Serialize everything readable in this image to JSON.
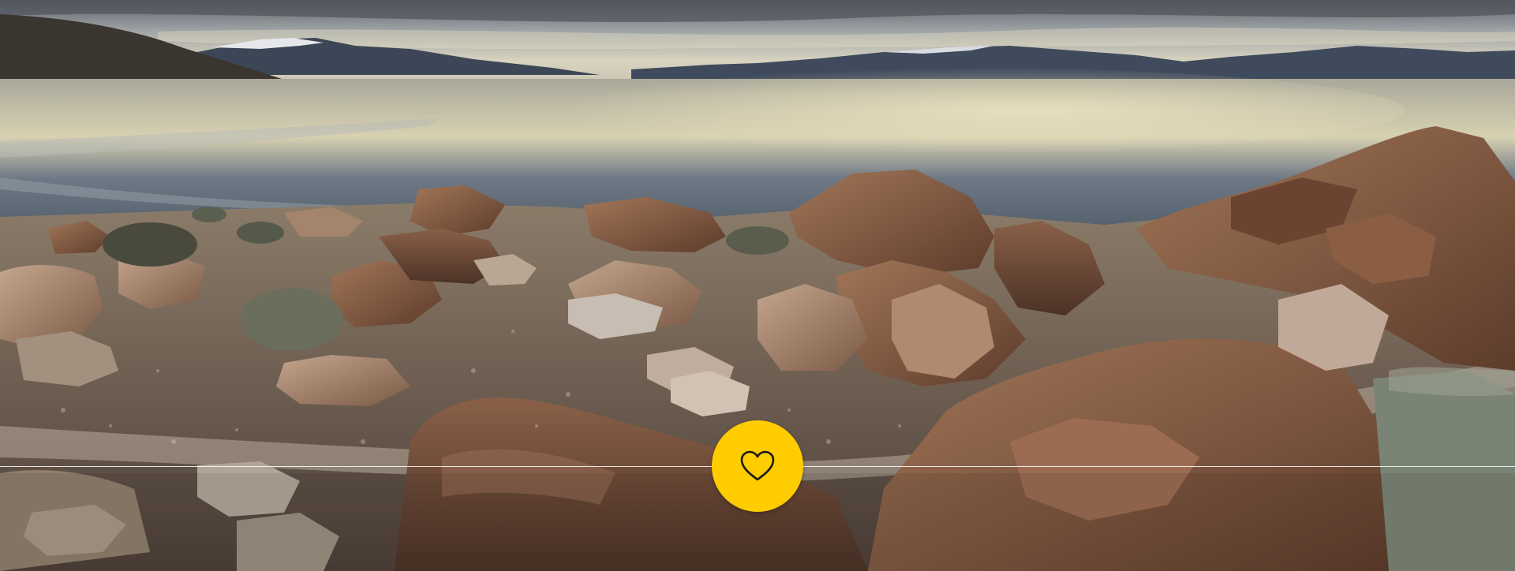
{
  "hero": {
    "image_subject": "rocky-lakeshore-landscape"
  },
  "favorite_button": {
    "icon": "heart-outline-icon",
    "background_color": "#FFCC00",
    "icon_color": "#1a1a1a"
  },
  "divider": {
    "color": "#ffffff"
  }
}
